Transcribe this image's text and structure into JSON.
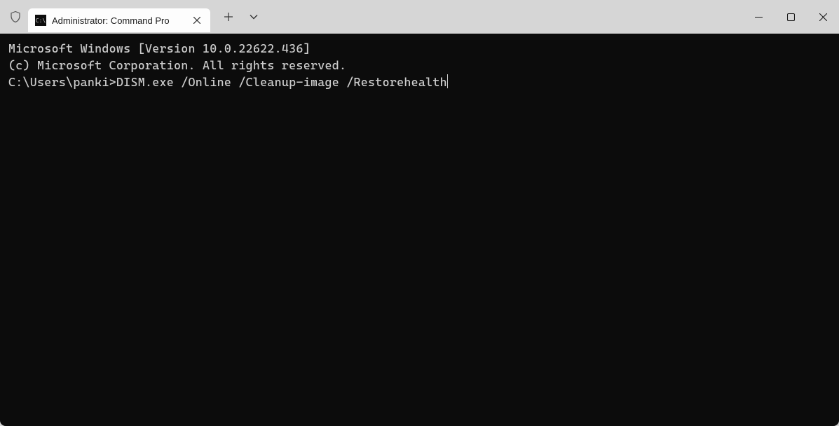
{
  "titlebar": {
    "tab": {
      "title": "Administrator: Command Pro",
      "icon_label": "cmd"
    }
  },
  "terminal": {
    "line1": "Microsoft Windows [Version 10.0.22622.436]",
    "line2": "(c) Microsoft Corporation. All rights reserved.",
    "blank": "",
    "prompt": "C:\\Users\\panki>",
    "command": "DISM.exe /Online /Cleanup-image /Restorehealth"
  }
}
